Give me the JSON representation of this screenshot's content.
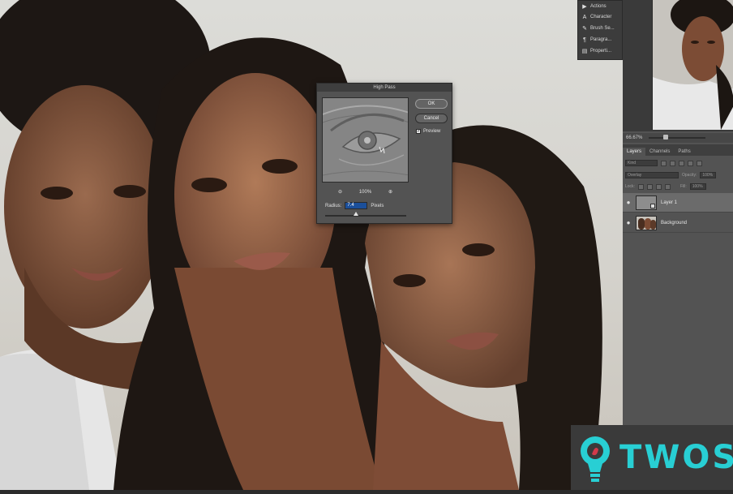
{
  "canvas": {
    "alt": "Photo of three women being sharpened with High Pass filter"
  },
  "mini_panel": {
    "items": [
      {
        "icon": "play-icon",
        "glyph": "▶",
        "label": "Actions"
      },
      {
        "icon": "character-icon",
        "glyph": "A",
        "label": "Character"
      },
      {
        "icon": "brush-icon",
        "glyph": "✎",
        "label": "Brush Se..."
      },
      {
        "icon": "paragraph-icon",
        "glyph": "¶",
        "label": "Paragra..."
      },
      {
        "icon": "properties-icon",
        "glyph": "▤",
        "label": "Properti..."
      }
    ]
  },
  "navigator": {
    "zoom": "66.67%"
  },
  "layers_panel": {
    "tabs": [
      "Layers",
      "Channels",
      "Paths"
    ],
    "active_tab": "Layers",
    "filter_kind": "Kind",
    "blend_mode": "Overlay",
    "opacity_label": "Opacity:",
    "opacity_value": "100%",
    "lock_label": "Lock:",
    "fill_label": "Fill:",
    "fill_value": "100%",
    "layers": [
      {
        "name": "Layer 1",
        "selected": true
      },
      {
        "name": "Background",
        "selected": false
      }
    ]
  },
  "dialog": {
    "title": "High Pass",
    "ok_label": "OK",
    "cancel_label": "Cancel",
    "preview_label": "Preview",
    "preview_checked": true,
    "zoom_level": "100%",
    "zoom_out_glyph": "⊖",
    "zoom_in_glyph": "⊕",
    "radius_label": "Radius:",
    "radius_value": "7.4",
    "radius_unit": "Pixels",
    "radius_slider_fraction": 0.38
  },
  "watermark": {
    "text": "TWOS",
    "color": "#28cfd4"
  }
}
